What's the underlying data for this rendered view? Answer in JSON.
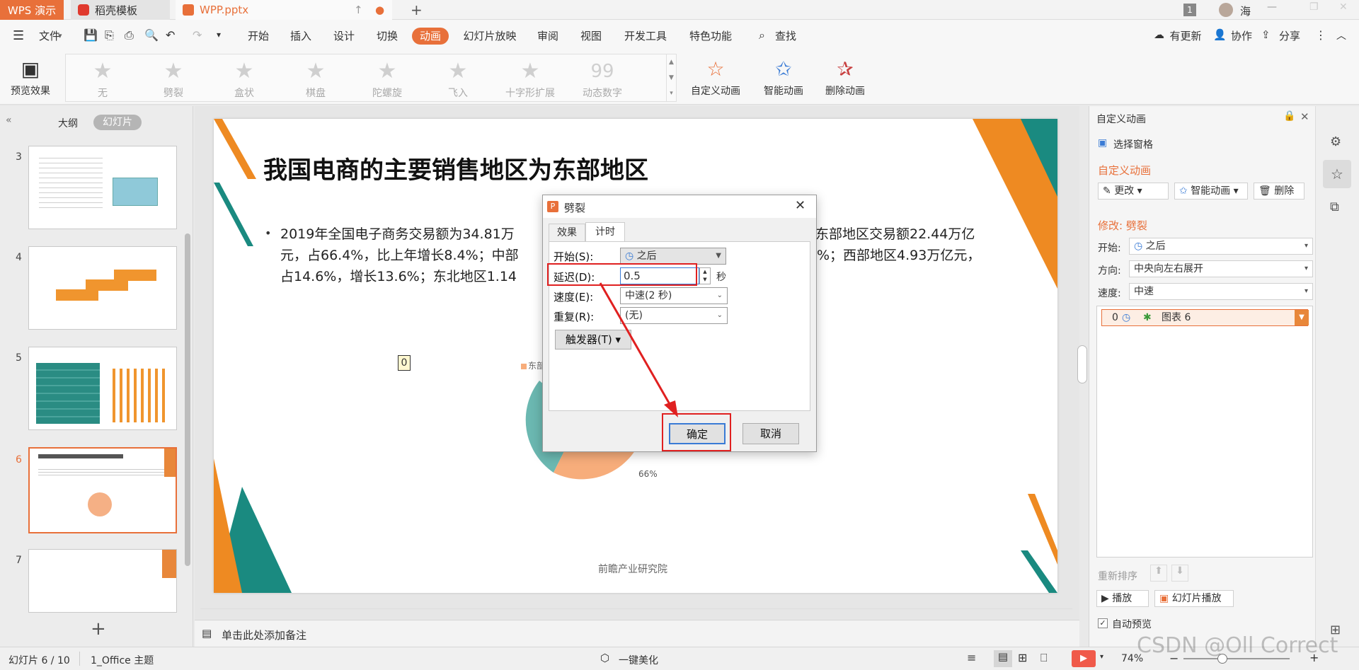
{
  "titlebar": {
    "app_tab": "WPS 演示",
    "template_tab": "稻壳模板",
    "doc_tab": "WPP.pptx",
    "new_tab": "+",
    "badge": "1",
    "user": "海"
  },
  "menubar": {
    "file": "文件",
    "items": [
      "开始",
      "插入",
      "设计",
      "切换",
      "动画",
      "幻灯片放映",
      "审阅",
      "视图",
      "开发工具",
      "特色功能"
    ],
    "search": "查找",
    "update": "有更新",
    "collab": "协作",
    "share": "分享"
  },
  "ribbon": {
    "preview": "预览效果",
    "effects": [
      "无",
      "劈裂",
      "盒状",
      "棋盘",
      "陀螺旋",
      "飞入",
      "十字形扩展",
      "动态数字"
    ],
    "custom_anim": "自定义动画",
    "smart_anim": "智能动画",
    "delete_anim": "删除动画"
  },
  "leftpanel": {
    "outline_tab": "大纲",
    "slides_tab": "幻灯片",
    "slide_numbers": [
      "3",
      "4",
      "5",
      "6",
      "7"
    ],
    "add": "+"
  },
  "slide": {
    "title": "我国电商的主要销售地区为东部地区",
    "bullet_line1": "2019年全国电子商务交易额为34.81万",
    "bullet_line1_right": "东部地区交易额22.44万亿",
    "bullet_line2": "元，占66.4%，比上年增长8.4%；中部",
    "bullet_line2_right": "%；西部地区4.93万亿元，",
    "bullet_line3": "占14.6%，增长13.6%；东北地区1.14",
    "anim_tag": "0",
    "legend_fragment": "东部",
    "pie_label": "66%",
    "source": "前瞻产业研究院"
  },
  "notes": {
    "placeholder": "单击此处添加备注"
  },
  "dialog": {
    "title": "劈裂",
    "tab_effect": "效果",
    "tab_timing": "计时",
    "start_label": "开始(S):",
    "start_value": "之后",
    "delay_label": "延迟(D):",
    "delay_value": "0.5",
    "delay_unit": "秒",
    "speed_label": "速度(E):",
    "speed_value": "中速(2 秒)",
    "repeat_label": "重复(R):",
    "repeat_value": "(无)",
    "trigger": "触发器(T)",
    "ok": "确定",
    "cancel": "取消"
  },
  "rightpanel": {
    "header": "自定义动画",
    "select_pane": "选择窗格",
    "section_title": "自定义动画",
    "change": "更改",
    "smart": "智能动画",
    "delete": "删除",
    "modify": "修改: 劈裂",
    "start_label": "开始:",
    "start_value": "之后",
    "direction_label": "方向:",
    "direction_value": "中央向左右展开",
    "speed_label": "速度:",
    "speed_value": "中速",
    "item_index": "0",
    "item_name": "图表 6",
    "reorder": "重新排序",
    "play": "播放",
    "slideshow": "幻灯片播放",
    "auto_preview": "自动预览"
  },
  "statusbar": {
    "slide_count": "幻灯片 6 / 10",
    "theme": "1_Office 主题",
    "beautify": "一键美化",
    "zoom": "74%",
    "watermark": "CSDN @Oll Correct"
  },
  "colors": {
    "accent_orange": "#e8703a",
    "teal": "#1a8a80",
    "highlight_red": "#e02020"
  }
}
